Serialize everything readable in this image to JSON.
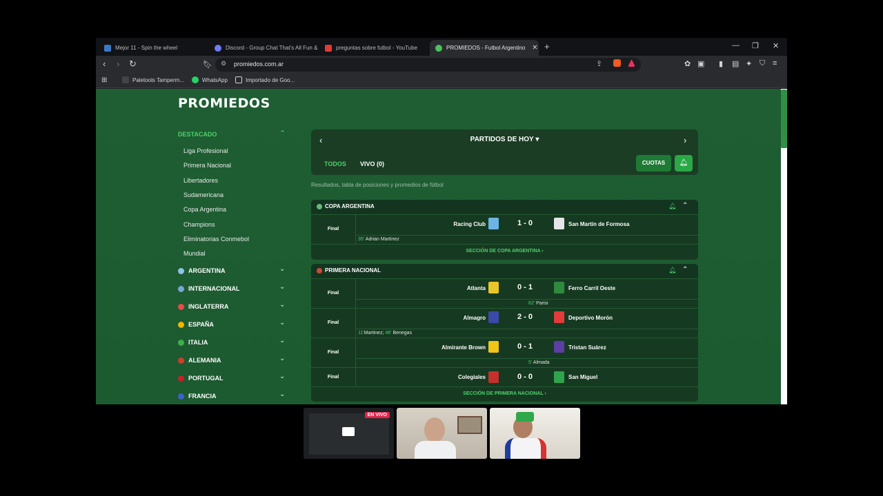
{
  "browser": {
    "tabs": [
      {
        "title": "Mejor 11 - Spin the wheel",
        "color": "#3c78c8"
      },
      {
        "title": "Discord - Group Chat That's All Fun &",
        "color": "#6f7bf7"
      },
      {
        "title": "preguntas sobre futbol - YouTube",
        "color": "#e53935"
      },
      {
        "title": "PROMIEDOS - Futbol Argentino",
        "color": "#4cc25e"
      }
    ],
    "url": "promiedos.com.ar",
    "bookmarks": [
      "Paletools Tamperm...",
      "WhatsApp",
      "Importado de Goo..."
    ]
  },
  "site": {
    "logo": "PROMIEDOS",
    "sidebar": {
      "heading": "DESTACADO",
      "links": [
        "Liga Profesional",
        "Primera Nacional",
        "Libertadores",
        "Sudamericana",
        "Copa Argentina",
        "Champions",
        "Eliminatorias Conmebol",
        "Mundial"
      ],
      "countries": [
        {
          "name": "ARGENTINA",
          "flag": "#8fc3e6"
        },
        {
          "name": "INTERNACIONAL",
          "flag": "#7aa5d6"
        },
        {
          "name": "INGLATERRA",
          "flag": "#e84a4a"
        },
        {
          "name": "ESPAÑA",
          "flag": "#f2b600"
        },
        {
          "name": "ITALIA",
          "flag": "#3fae49"
        },
        {
          "name": "ALEMANIA",
          "flag": "#d23c2e"
        },
        {
          "name": "PORTUGAL",
          "flag": "#c8202a"
        },
        {
          "name": "FRANCIA",
          "flag": "#3b63c9"
        }
      ]
    },
    "day_header": "PARTIDOS DE HOY",
    "filter_all": "TODOS",
    "filter_live": "VIVO (0)",
    "cuotas": "CUOTAS",
    "subtitle": "Resultados, tabla de posiciones y promedios de fútbol",
    "leagues": [
      {
        "name": "COPA ARGENTINA",
        "section_link": "SECCIÓN DE COPA ARGENTINA ›",
        "matches": [
          {
            "status": "Final",
            "home": "Racing Club",
            "score": "1 - 0",
            "away": "San Martín de Formosa",
            "home_color": "#6ab4e6",
            "away_color": "#e6e6e6",
            "events": [
              {
                "min": "35'",
                "player": "Adrian Martinez",
                "side": "home"
              }
            ]
          }
        ]
      },
      {
        "name": "PRIMERA NACIONAL",
        "section_link": "SECCIÓN DE PRIMERA NACIONAL ›",
        "matches": [
          {
            "status": "Final",
            "home": "Atlanta",
            "score": "0 - 1",
            "away": "Ferro Carril Oeste",
            "home_color": "#e8c52a",
            "away_color": "#2e8b3e",
            "events": [
              {
                "min": "62'",
                "player": "Parisi",
                "side": "away"
              }
            ]
          },
          {
            "status": "Final",
            "home": "Almagro",
            "score": "2 - 0",
            "away": "Deportivo Morón",
            "home_color": "#3b4aa8",
            "away_color": "#e33b3b",
            "events": [
              {
                "min": "11'",
                "player": "Martinez;",
                "side": "home"
              },
              {
                "min": "46'",
                "player": "Benegas",
                "side": "home2"
              }
            ]
          },
          {
            "status": "Final",
            "home": "Almirante Brown",
            "score": "0 - 1",
            "away": "Tristan Suárez",
            "home_color": "#f0c419",
            "away_color": "#5b3fa3",
            "events": [
              {
                "min": "5'",
                "player": "Almada",
                "side": "away"
              }
            ]
          },
          {
            "status": "Final",
            "home": "Colegiales",
            "score": "0 - 0",
            "away": "San Miguel",
            "home_color": "#c4302b",
            "away_color": "#2fa44a",
            "events": []
          }
        ]
      }
    ]
  },
  "call": {
    "live_badge": "EN VIVO"
  }
}
